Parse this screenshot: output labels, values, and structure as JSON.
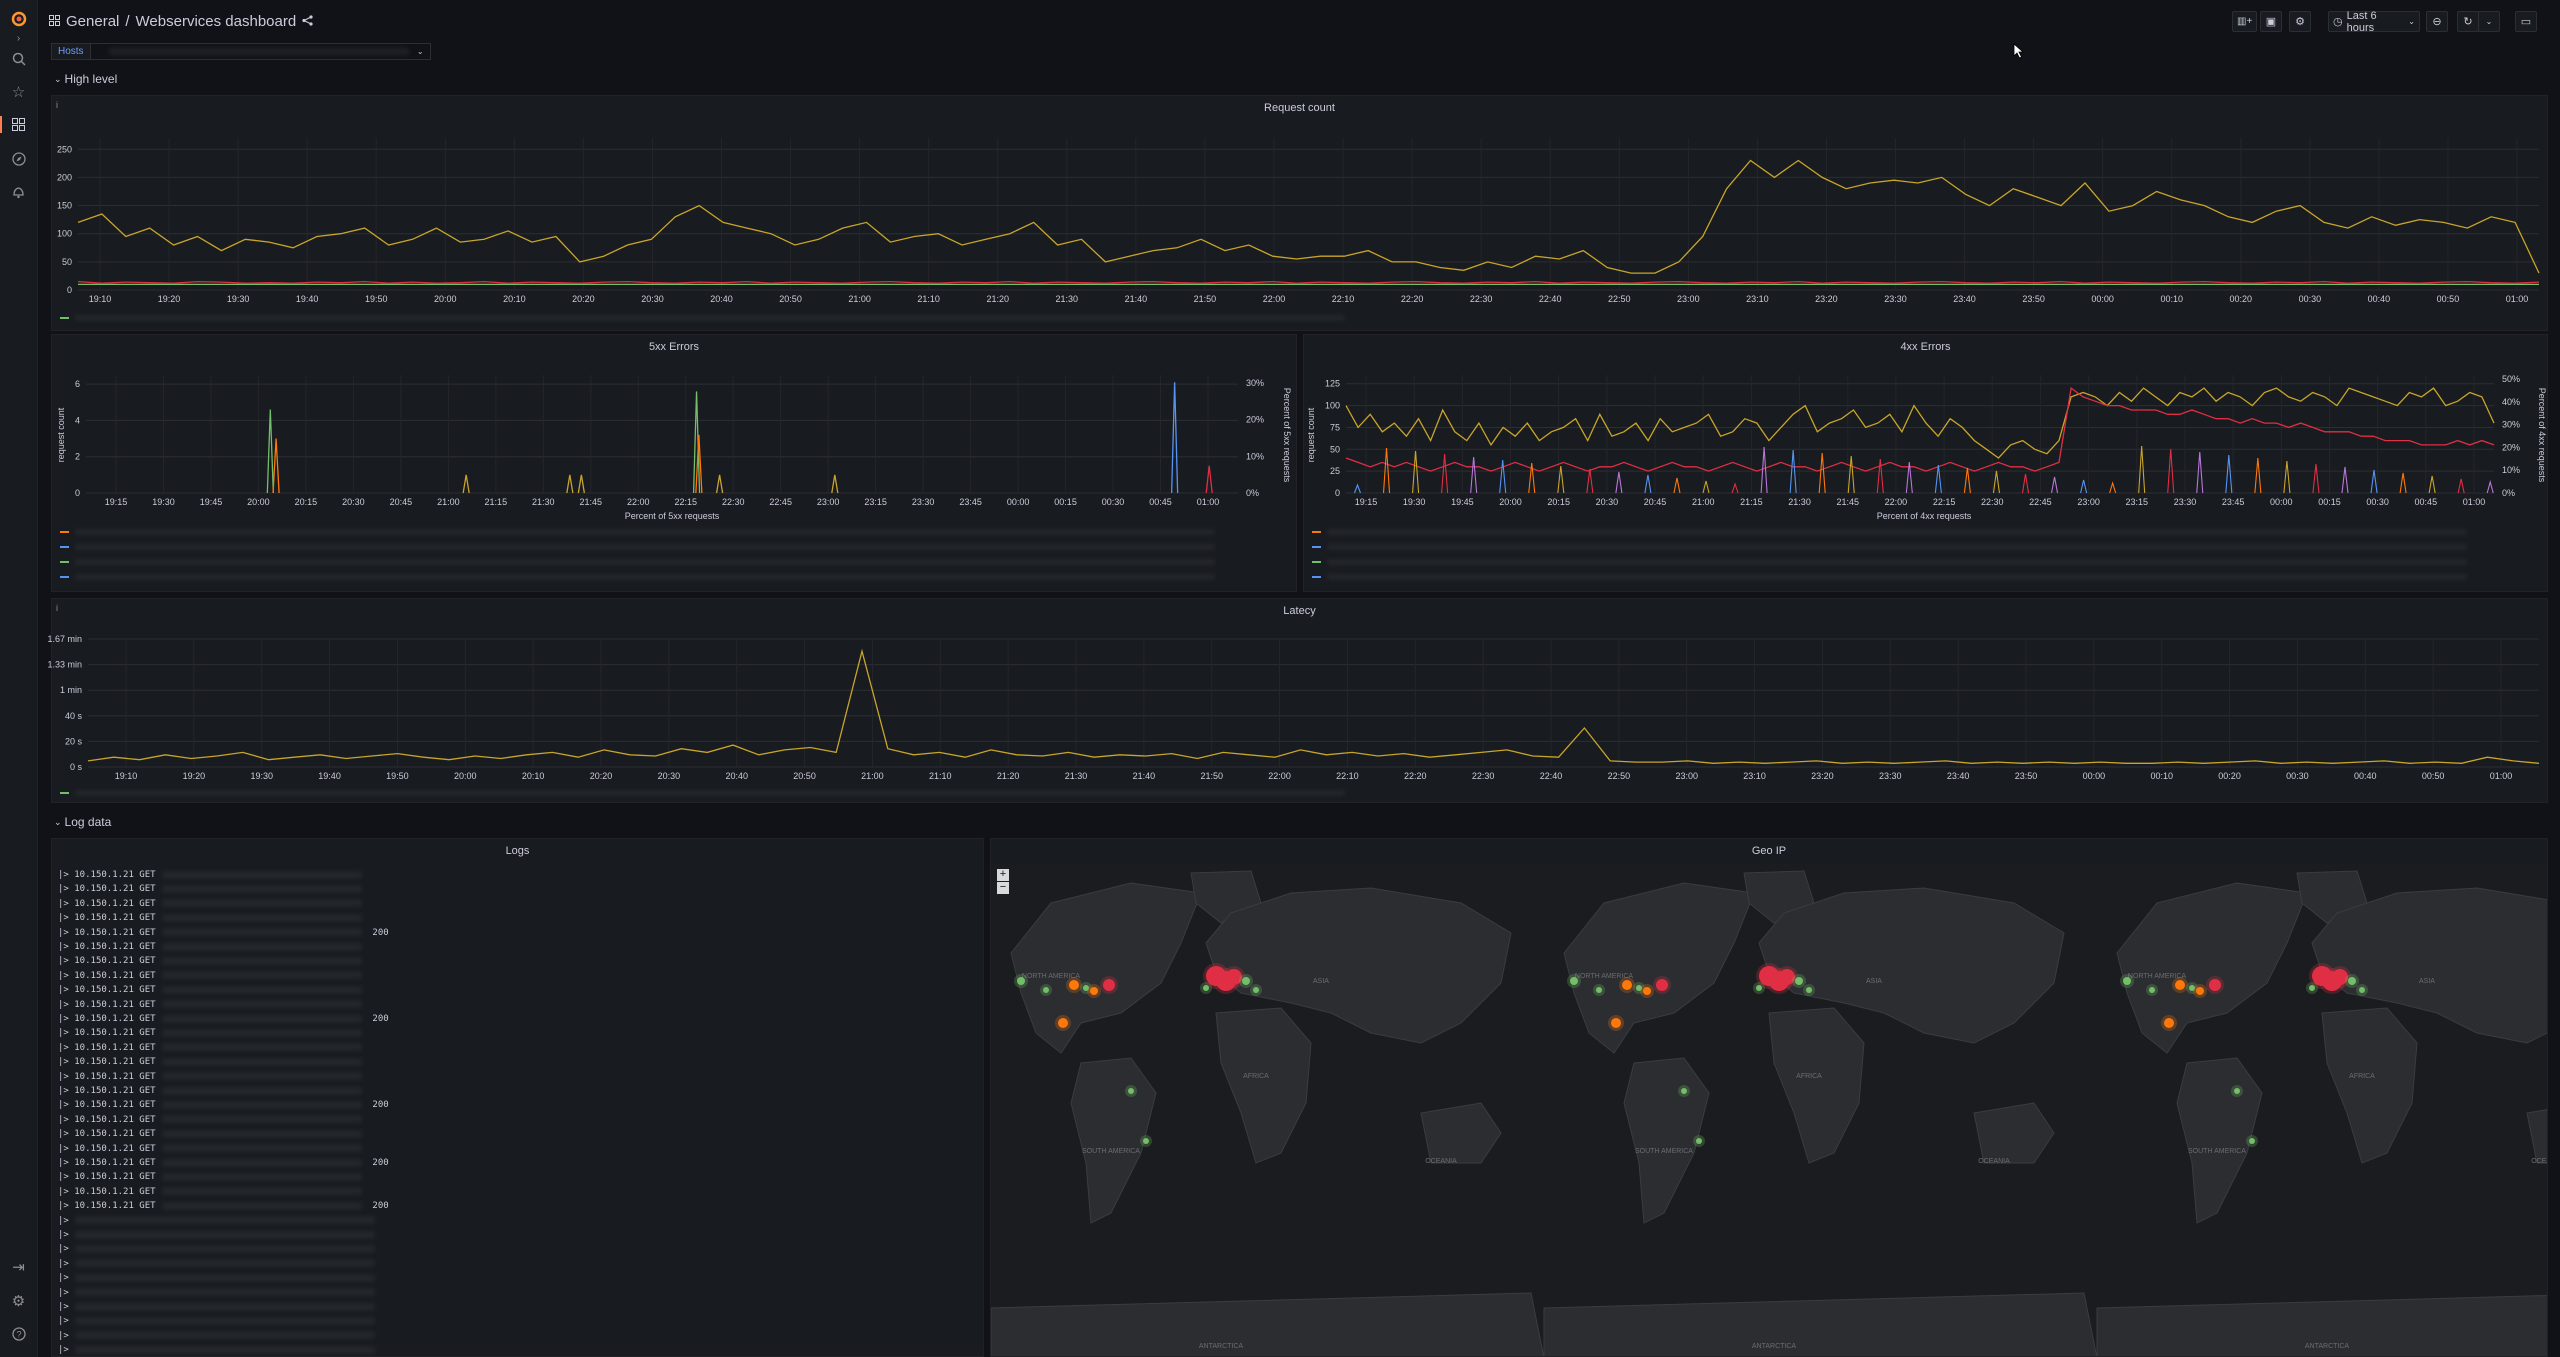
{
  "breadcrumb": {
    "folder": "General",
    "separator": "/",
    "title": "Webservices dashboard"
  },
  "toolbar": {
    "time_range": "Last 6 hours"
  },
  "variables": {
    "hosts_label": "Hosts"
  },
  "rows": {
    "high_level": "High level",
    "log_data": "Log data"
  },
  "panels": {
    "request_count": {
      "title": "Request count"
    },
    "errors_5xx": {
      "title": "5xx Errors",
      "ylabel": "request count",
      "y2label": "Percent of 5xx requests",
      "xlabel": "Percent of 5xx requests"
    },
    "errors_4xx": {
      "title": "4xx Errors",
      "ylabel": "request count",
      "y2label": "Percent of 4xx requests",
      "xlabel": "Percent of 4xx requests"
    },
    "latency": {
      "title": "Latecy"
    },
    "logs": {
      "title": "Logs"
    },
    "geoip": {
      "title": "Geo IP",
      "zoom_in": "+",
      "zoom_out": "−"
    }
  },
  "logs": {
    "entries": [
      {
        "ip": "10.150.1.21",
        "method": "GET"
      },
      {
        "ip": "10.150.1.21",
        "method": "GET"
      },
      {
        "ip": "10.150.1.21",
        "method": "GET"
      },
      {
        "ip": "10.150.1.21",
        "method": "GET"
      },
      {
        "ip": "10.150.1.21",
        "method": "GET",
        "status": "200"
      },
      {
        "ip": "10.150.1.21",
        "method": "GET"
      },
      {
        "ip": "10.150.1.21",
        "method": "GET"
      },
      {
        "ip": "10.150.1.21",
        "method": "GET"
      },
      {
        "ip": "10.150.1.21",
        "method": "GET"
      },
      {
        "ip": "10.150.1.21",
        "method": "GET"
      },
      {
        "ip": "10.150.1.21",
        "method": "GET",
        "status": "200"
      },
      {
        "ip": "10.150.1.21",
        "method": "GET"
      },
      {
        "ip": "10.150.1.21",
        "method": "GET"
      },
      {
        "ip": "10.150.1.21",
        "method": "GET"
      },
      {
        "ip": "10.150.1.21",
        "method": "GET"
      },
      {
        "ip": "10.150.1.21",
        "method": "GET"
      },
      {
        "ip": "10.150.1.21",
        "method": "GET",
        "status": "200"
      },
      {
        "ip": "10.150.1.21",
        "method": "GET"
      },
      {
        "ip": "10.150.1.21",
        "method": "GET"
      },
      {
        "ip": "10.150.1.21",
        "method": "GET"
      },
      {
        "ip": "10.150.1.21",
        "method": "GET",
        "status": "200"
      },
      {
        "ip": "10.150.1.21",
        "method": "GET"
      },
      {
        "ip": "10.150.1.21",
        "method": "GET"
      },
      {
        "ip": "10.150.1.21",
        "method": "GET",
        "status": "200"
      }
    ],
    "empty_rows": 10
  },
  "map_labels": {
    "continents": [
      "NORTH AMERICA",
      "SOUTH AMERICA",
      "ASIA",
      "AFRICA",
      "OCEANIA",
      "ANTARCTICA"
    ]
  },
  "colors": {
    "yellow": "#c8a52a",
    "green": "#73bf69",
    "blue": "#5794f2",
    "red": "#e02f44",
    "orange": "#ff780a",
    "purple": "#b877d9"
  },
  "chart_data": [
    {
      "type": "line",
      "title": "Request count",
      "x_ticks": [
        "19:10",
        "19:20",
        "19:30",
        "19:40",
        "19:50",
        "20:00",
        "20:10",
        "20:20",
        "20:30",
        "20:40",
        "20:50",
        "21:00",
        "21:10",
        "21:20",
        "21:30",
        "21:40",
        "21:50",
        "22:00",
        "22:10",
        "22:20",
        "22:30",
        "22:40",
        "22:50",
        "23:00",
        "23:10",
        "23:20",
        "23:30",
        "23:40",
        "23:50",
        "00:00",
        "00:10",
        "00:20",
        "00:30",
        "00:40",
        "00:50",
        "01:00"
      ],
      "y_ticks": [
        0,
        50,
        100,
        150,
        200,
        250
      ],
      "ylim": [
        0,
        270
      ],
      "series": [
        {
          "color": "#c8a52a",
          "values": [
            120,
            135,
            95,
            110,
            80,
            95,
            70,
            90,
            85,
            75,
            95,
            100,
            110,
            80,
            90,
            110,
            85,
            90,
            105,
            85,
            95,
            50,
            60,
            80,
            90,
            130,
            150,
            120,
            110,
            100,
            80,
            90,
            110,
            120,
            85,
            95,
            100,
            80,
            90,
            100,
            120,
            80,
            90,
            50,
            60,
            70,
            75,
            90,
            70,
            80,
            60,
            55,
            60,
            60,
            70,
            50,
            50,
            40,
            35,
            50,
            40,
            60,
            55,
            70,
            40,
            30,
            30,
            50,
            95,
            180,
            230,
            200,
            230,
            200,
            180,
            190,
            195,
            190,
            200,
            170,
            150,
            180,
            165,
            150,
            190,
            140,
            150,
            175,
            160,
            150,
            130,
            120,
            140,
            150,
            120,
            110,
            130,
            115,
            125,
            120,
            110,
            130,
            120,
            30
          ]
        },
        {
          "color": "#73bf69",
          "values": [
            10,
            10,
            10,
            10,
            10,
            10,
            10,
            10,
            10,
            10,
            10,
            10,
            10,
            10,
            10,
            10,
            10,
            10,
            10,
            10,
            10,
            10,
            10,
            10,
            10,
            10,
            10,
            10,
            10,
            10,
            10,
            10,
            10,
            10,
            10,
            10,
            10,
            10,
            10,
            10,
            10,
            10,
            10,
            10,
            10,
            10,
            10,
            10,
            10,
            10,
            10,
            10,
            10,
            10,
            10,
            10,
            10,
            10,
            10,
            10,
            10,
            10,
            10,
            10,
            10,
            10,
            10,
            10,
            10,
            10,
            10,
            10,
            10,
            10,
            10,
            10,
            10,
            10,
            10,
            10,
            10,
            10,
            10,
            10,
            10,
            10,
            10,
            10,
            10,
            10,
            10,
            10,
            10,
            10,
            10,
            10,
            10,
            10,
            10,
            10,
            10,
            10,
            10,
            10
          ]
        },
        {
          "color": "#e02f44",
          "values": [
            15,
            12,
            14,
            13,
            12,
            15,
            14,
            12,
            13,
            12,
            14,
            13,
            15,
            12,
            14,
            12,
            13,
            15,
            12,
            14,
            13,
            12,
            14,
            15,
            13,
            12,
            14,
            13,
            15,
            12,
            14,
            13,
            12,
            14,
            15,
            13,
            12,
            14,
            13,
            15,
            12,
            14,
            13,
            12,
            14,
            15,
            13,
            12,
            14,
            13,
            15,
            12,
            14,
            13,
            12,
            14,
            15,
            13,
            12,
            14,
            13,
            15,
            12,
            14,
            13,
            12,
            14,
            15,
            13,
            12,
            14,
            13,
            15,
            12,
            14,
            13,
            12,
            14,
            15,
            13,
            12,
            14,
            13,
            15,
            12,
            14,
            13,
            12,
            14,
            15,
            13,
            12,
            14,
            13,
            15,
            12,
            14,
            13,
            12,
            14,
            15,
            13,
            12,
            14
          ]
        }
      ]
    },
    {
      "type": "line",
      "title": "5xx Errors",
      "ylabel": "request count",
      "y2label": "Percent of 5xx requests",
      "x_ticks": [
        "19:15",
        "19:30",
        "19:45",
        "20:00",
        "20:15",
        "20:30",
        "20:45",
        "21:00",
        "21:15",
        "21:30",
        "21:45",
        "22:00",
        "22:15",
        "22:30",
        "22:45",
        "23:00",
        "23:15",
        "23:30",
        "23:45",
        "00:00",
        "00:15",
        "00:30",
        "00:45",
        "01:00"
      ],
      "y_ticks": [
        0,
        2,
        4,
        6
      ],
      "y2_ticks": [
        "0%",
        "10%",
        "20%",
        "30%"
      ],
      "ylim": [
        0,
        6.5
      ],
      "spikes": [
        {
          "t": 0.16,
          "v": 4.6,
          "color": "#73bf69"
        },
        {
          "t": 0.165,
          "v": 3,
          "color": "#ff780a"
        },
        {
          "t": 0.33,
          "v": 1,
          "color": "#c8a52a"
        },
        {
          "t": 0.42,
          "v": 1,
          "color": "#c8a52a"
        },
        {
          "t": 0.43,
          "v": 1,
          "color": "#c8a52a"
        },
        {
          "t": 0.53,
          "v": 5.6,
          "color": "#73bf69"
        },
        {
          "t": 0.532,
          "v": 3.2,
          "color": "#ff780a"
        },
        {
          "t": 0.55,
          "v": 1,
          "color": "#c8a52a"
        },
        {
          "t": 0.65,
          "v": 1,
          "color": "#c8a52a"
        },
        {
          "t": 0.945,
          "v": 6.1,
          "color": "#5794f2"
        },
        {
          "t": 0.975,
          "v": 1.5,
          "color": "#e02f44"
        }
      ]
    },
    {
      "type": "line",
      "title": "4xx Errors",
      "ylabel": "request count",
      "y2label": "Percent of 4xx requests",
      "x_ticks": [
        "19:15",
        "19:30",
        "19:45",
        "20:00",
        "20:15",
        "20:30",
        "20:45",
        "21:00",
        "21:15",
        "21:30",
        "21:45",
        "22:00",
        "22:15",
        "22:30",
        "22:45",
        "23:00",
        "23:15",
        "23:30",
        "23:45",
        "00:00",
        "00:15",
        "00:30",
        "00:45",
        "01:00"
      ],
      "y_ticks": [
        0,
        25,
        50,
        75,
        100,
        125
      ],
      "y2_ticks": [
        "0%",
        "10%",
        "20%",
        "30%",
        "40%",
        "50%"
      ],
      "ylim": [
        0,
        135
      ],
      "series": [
        {
          "color": "#c8a52a",
          "values": [
            100,
            75,
            90,
            70,
            80,
            65,
            85,
            60,
            95,
            70,
            60,
            80,
            55,
            75,
            65,
            80,
            60,
            70,
            75,
            85,
            60,
            90,
            65,
            70,
            80,
            60,
            85,
            70,
            75,
            80,
            90,
            65,
            70,
            85,
            80,
            60,
            75,
            90,
            100,
            70,
            80,
            85,
            95,
            75,
            80,
            90,
            70,
            100,
            80,
            65,
            85,
            75,
            60,
            50,
            40,
            55,
            60,
            50,
            45,
            60,
            110,
            115,
            110,
            100,
            115,
            105,
            120,
            110,
            100,
            115,
            110,
            120,
            105,
            115,
            110,
            100,
            115,
            120,
            110,
            105,
            115,
            110,
            100,
            120,
            115,
            110,
            105,
            100,
            115,
            110,
            120,
            100,
            105,
            115,
            110,
            80
          ]
        },
        {
          "color": "#e02f44",
          "values": [
            40,
            35,
            30,
            35,
            30,
            35,
            30,
            25,
            30,
            35,
            30,
            30,
            25,
            30,
            35,
            30,
            25,
            30,
            35,
            30,
            25,
            30,
            30,
            35,
            30,
            25,
            30,
            35,
            30,
            30,
            25,
            30,
            35,
            30,
            25,
            30,
            35,
            30,
            30,
            25,
            30,
            35,
            30,
            25,
            30,
            35,
            30,
            30,
            25,
            30,
            35,
            30,
            25,
            30,
            35,
            30,
            30,
            25,
            30,
            35,
            120,
            110,
            105,
            100,
            100,
            95,
            95,
            95,
            90,
            90,
            95,
            90,
            85,
            85,
            80,
            85,
            80,
            80,
            75,
            80,
            75,
            70,
            70,
            70,
            65,
            65,
            60,
            60,
            60,
            55,
            55,
            55,
            60,
            55,
            60,
            55
          ]
        }
      ]
    },
    {
      "type": "line",
      "title": "Latecy",
      "x_ticks": [
        "19:10",
        "19:20",
        "19:30",
        "19:40",
        "19:50",
        "20:00",
        "20:10",
        "20:20",
        "20:30",
        "20:40",
        "20:50",
        "21:00",
        "21:10",
        "21:20",
        "21:30",
        "21:40",
        "21:50",
        "22:00",
        "22:10",
        "22:20",
        "22:30",
        "22:40",
        "22:50",
        "23:00",
        "23:10",
        "23:20",
        "23:30",
        "23:40",
        "23:50",
        "00:00",
        "00:10",
        "00:20",
        "00:30",
        "00:40",
        "00:50",
        "01:00"
      ],
      "y_ticks": [
        "0 s",
        "20 s",
        "40 s",
        "1 min",
        "1.33 min",
        "1.67 min"
      ],
      "ylim": [
        0,
        105
      ],
      "series": [
        {
          "color": "#c8a52a",
          "values": [
            5,
            8,
            6,
            10,
            7,
            9,
            12,
            6,
            8,
            10,
            7,
            9,
            11,
            8,
            6,
            9,
            7,
            10,
            12,
            8,
            14,
            10,
            9,
            15,
            12,
            18,
            10,
            14,
            16,
            12,
            95,
            15,
            10,
            12,
            8,
            14,
            10,
            9,
            12,
            8,
            10,
            9,
            11,
            7,
            12,
            10,
            8,
            14,
            10,
            12,
            9,
            11,
            8,
            10,
            12,
            14,
            9,
            8,
            32,
            5,
            4,
            4,
            5,
            3,
            4,
            3,
            4,
            5,
            3,
            4,
            3,
            4,
            5,
            3,
            4,
            3,
            4,
            3,
            4,
            3,
            3,
            4,
            3,
            4,
            5,
            3,
            4,
            3,
            4,
            5,
            3,
            4,
            3,
            8,
            5,
            3
          ]
        }
      ]
    }
  ]
}
